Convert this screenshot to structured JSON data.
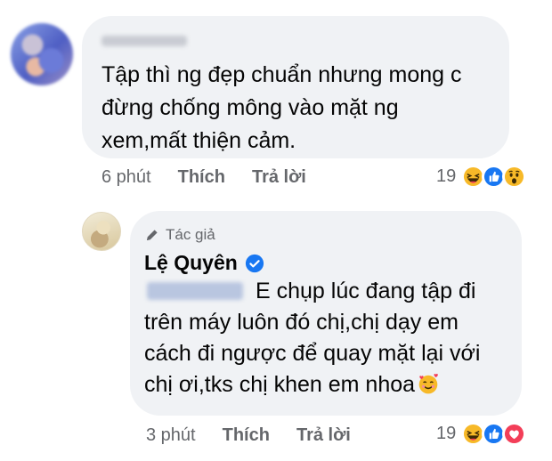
{
  "comment": {
    "text_lines": [
      "Tập thì ng đẹp chuẩn nhưng mong c",
      "đừng chống mông vào mặt ng",
      "xem,mất thiện cảm."
    ],
    "time": "6 phút",
    "like_label": "Thích",
    "reply_label": "Trả lời",
    "reaction_count": "19",
    "reaction_icons": [
      "haha-icon",
      "like-icon",
      "wow-icon"
    ]
  },
  "reply": {
    "author_badge": "Tác giả",
    "author_name": "Lệ Quyên",
    "text_lines": [
      "E chụp lúc đang tập đi",
      "trên máy luôn đó chị,chị dạy em",
      "cách đi ngược để quay mặt lại với",
      "chị ơi,tks chị khen em nhoa"
    ],
    "trailing_emoji": "smiling-face-with-hearts-icon",
    "time": "3 phút",
    "like_label": "Thích",
    "reply_label": "Trả lời",
    "reaction_count": "19",
    "reaction_icons": [
      "haha-icon",
      "like-icon",
      "love-icon"
    ]
  },
  "colors": {
    "bubble": "#f0f2f5",
    "meta_text": "#65676b",
    "like_blue": "#1877f2",
    "love_red": "#f33e58",
    "haha_yellow": "#f7b928"
  }
}
